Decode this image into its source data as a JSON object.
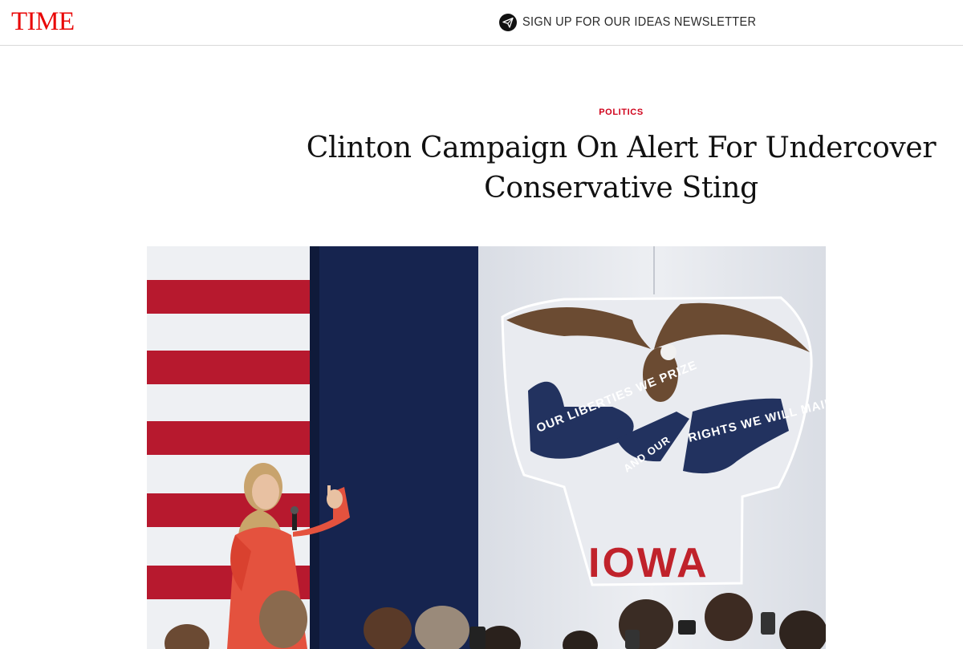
{
  "header": {
    "logo_text": "TIME",
    "newsletter_label": "SIGN UP FOR OUR IDEAS NEWSLETTER",
    "newsletter_icon": "paper-plane-icon"
  },
  "article": {
    "section": "POLITICS",
    "headline": "Clinton Campaign On Alert For Undercover Conservative Sting"
  },
  "hero_image": {
    "banner_left": "OUR LIBERTIES WE PRIZE",
    "banner_middle": "AND OUR",
    "banner_right": "RIGHTS WE WILL MAINTAIN",
    "state_name": "IOWA"
  },
  "colors": {
    "brand_red": "#e90606",
    "section_red": "#d0021b",
    "flag_red": "#b7192e",
    "flag_blue": "#16244f"
  }
}
